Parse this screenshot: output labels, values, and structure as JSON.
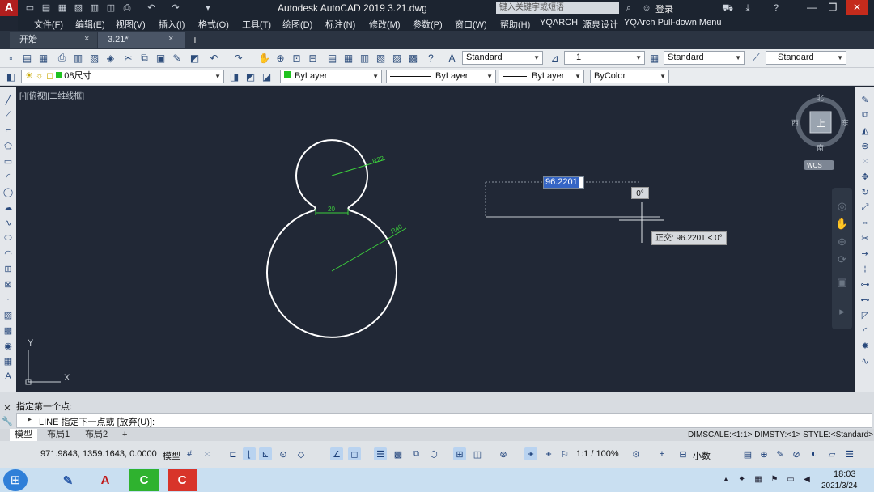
{
  "titlebar": {
    "app_logo": "A",
    "title": "Autodesk AutoCAD 2019    3.21.dwg",
    "search_placeholder": "键入关键字或短语",
    "login": "登录"
  },
  "menu": [
    "文件(F)",
    "编辑(E)",
    "视图(V)",
    "插入(I)",
    "格式(O)",
    "工具(T)",
    "绘图(D)",
    "标注(N)",
    "修改(M)",
    "参数(P)",
    "窗口(W)",
    "帮助(H)",
    "YQARCH",
    "源泉设计",
    "YQArch Pull-down Menu"
  ],
  "tabs": [
    {
      "label": "开始",
      "close": "×"
    },
    {
      "label": "3.21*",
      "close": "×"
    }
  ],
  "new_tab": "+",
  "toolbar1": {
    "text_style": "Standard",
    "dim_scale": "1",
    "dim_style": "Standard",
    "table_style": "Standard"
  },
  "toolbar2": {
    "layer": "08尺寸",
    "color": "ByLayer",
    "linetype": "ByLayer",
    "lineweight": "ByLayer",
    "plotstyle": "ByColor"
  },
  "viewport_label": "[-][俯视][二维线框]",
  "viewcube": {
    "north": "北",
    "south": "南",
    "west": "西",
    "east": "东",
    "face": "上",
    "wcs": "WCS"
  },
  "drawing": {
    "dim_top": "R22",
    "dim_mid": "20",
    "dim_bottom": "R40",
    "ucs_x": "X",
    "ucs_y": "Y"
  },
  "dynamic_input": {
    "distance": "96.2201",
    "angle": "0°",
    "ortho_tooltip": "正交: 96.2201 < 0°"
  },
  "command": {
    "history": "指定第一个点:",
    "prompt": "LINE 指定下一点或 [放弃(U)]:"
  },
  "layout_tabs": [
    "模型",
    "布局1",
    "布局2",
    "+"
  ],
  "dim_status": "DIMSCALE:<1:1> DIMSTY:<1> STYLE:<Standard>",
  "status": {
    "coords": "971.9843, 1359.1643, 0.0000",
    "model": "模型",
    "scale": "1:1 / 100%",
    "units": "小数"
  },
  "clock": {
    "time": "18:03",
    "date": "2021/3/24"
  },
  "colors": {
    "canvas": "#212836",
    "title_bg": "#1c2430",
    "accent": "#3565c5"
  }
}
